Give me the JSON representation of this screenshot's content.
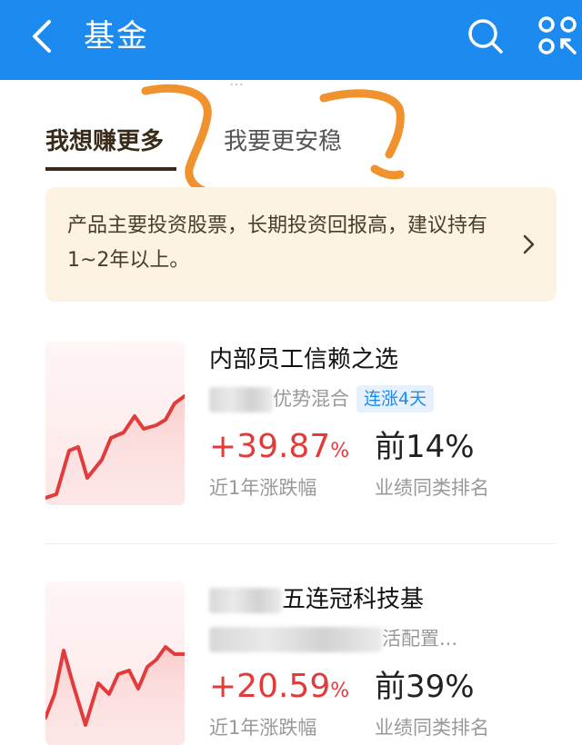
{
  "header": {
    "title": "基金",
    "color": "#1d8af0"
  },
  "faded_text": "…",
  "tabs": [
    {
      "label": "我想赚更多",
      "active": true
    },
    {
      "label": "我要更安稳",
      "active": false
    }
  ],
  "tip": {
    "text": "产品主要投资股票，长期投资回报高，建议持有1~2年以上。"
  },
  "funds": [
    {
      "name": "内部员工信赖之选",
      "sub_suffix": "优势混合",
      "badge": "连涨4天",
      "change": "+39.87",
      "change_unit": "%",
      "change_label": "近1年涨跌幅",
      "rank": "前14%",
      "rank_label": "业绩同类排名"
    },
    {
      "name_suffix": "五连冠科技基",
      "sub_suffix": "活配置...",
      "change": "+20.59",
      "change_unit": "%",
      "change_label": "近1年涨跌幅",
      "rank": "前39%",
      "rank_label": "业绩同类排名"
    }
  ],
  "colors": {
    "up": "#e23b3b",
    "annotation": "#f0922e",
    "tip_bg": "#fdf3e3"
  }
}
